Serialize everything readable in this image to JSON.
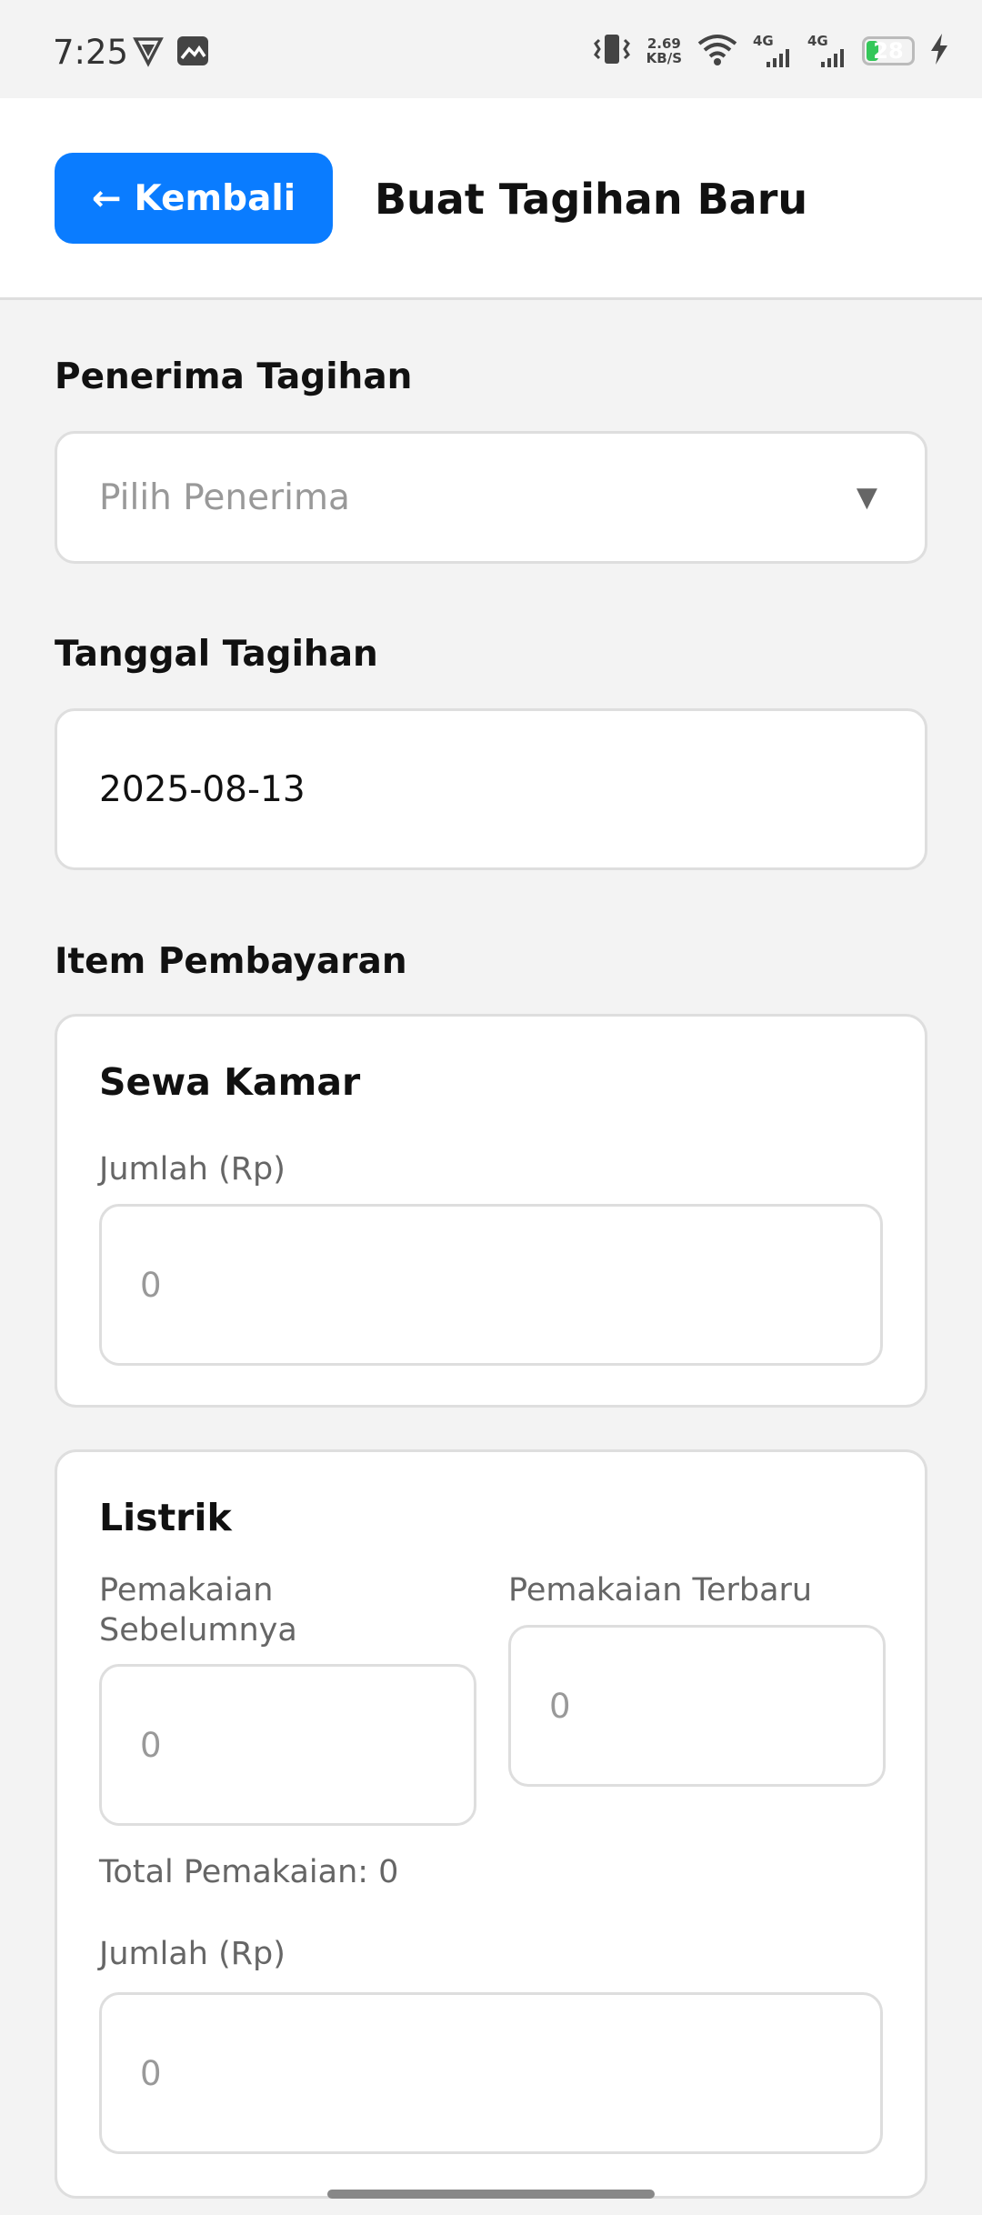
{
  "status_bar": {
    "time": "7:25",
    "net_speed_value": "2.69",
    "net_speed_unit": "KB/S",
    "signal1_label": "4G",
    "signal2_label": "4G",
    "battery_level": "28",
    "battery_color": "#34c759"
  },
  "header": {
    "back_arrow": "←",
    "back_label": "Kembali",
    "title": "Buat Tagihan Baru",
    "accent_color": "#0a7cff"
  },
  "form": {
    "recipient": {
      "label": "Penerima Tagihan",
      "placeholder": "Pilih Penerima",
      "caret": "▼"
    },
    "date": {
      "label": "Tanggal Tagihan",
      "value": "2025-08-13"
    },
    "items_heading": "Item Pembayaran",
    "room_rent": {
      "title": "Sewa Kamar",
      "amount_label": "Jumlah (Rp)",
      "amount_placeholder": "0"
    },
    "electricity": {
      "title": "Listrik",
      "previous_label_line1": "Pemakaian",
      "previous_label_line2": "Sebelumnya",
      "previous_placeholder": "0",
      "latest_label": "Pemakaian Terbaru",
      "latest_placeholder": "0",
      "total_usage": "Total Pemakaian: 0",
      "amount_label": "Jumlah (Rp)",
      "amount_placeholder": "0"
    }
  }
}
